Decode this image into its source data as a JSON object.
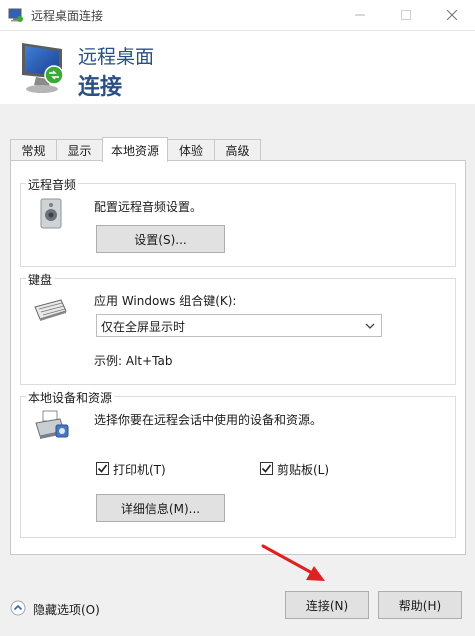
{
  "window": {
    "title": "远程桌面连接"
  },
  "banner": {
    "line1": "远程桌面",
    "line2": "连接"
  },
  "tabs": [
    {
      "label": "常规"
    },
    {
      "label": "显示"
    },
    {
      "label": "本地资源"
    },
    {
      "label": "体验"
    },
    {
      "label": "高级"
    }
  ],
  "audio": {
    "title": "远程音频",
    "description": "配置远程音频设置。",
    "settings_button": "设置(S)..."
  },
  "keyboard": {
    "title": "键盘",
    "label": "应用 Windows 组合键(K):",
    "selected": "仅在全屏显示时",
    "example": "示例: Alt+Tab"
  },
  "devices": {
    "title": "本地设备和资源",
    "description": "选择你要在远程会话中使用的设备和资源。",
    "printer_label": "打印机(T)",
    "printer_checked": true,
    "clipboard_label": "剪贴板(L)",
    "clipboard_checked": true,
    "details_button": "详细信息(M)..."
  },
  "footer": {
    "hide_options": "隐藏选项(O)",
    "connect_button": "连接(N)",
    "help_button": "帮助(H)"
  },
  "colors": {
    "banner_text": "#2a4f87",
    "annotation_arrow": "#e02020"
  }
}
